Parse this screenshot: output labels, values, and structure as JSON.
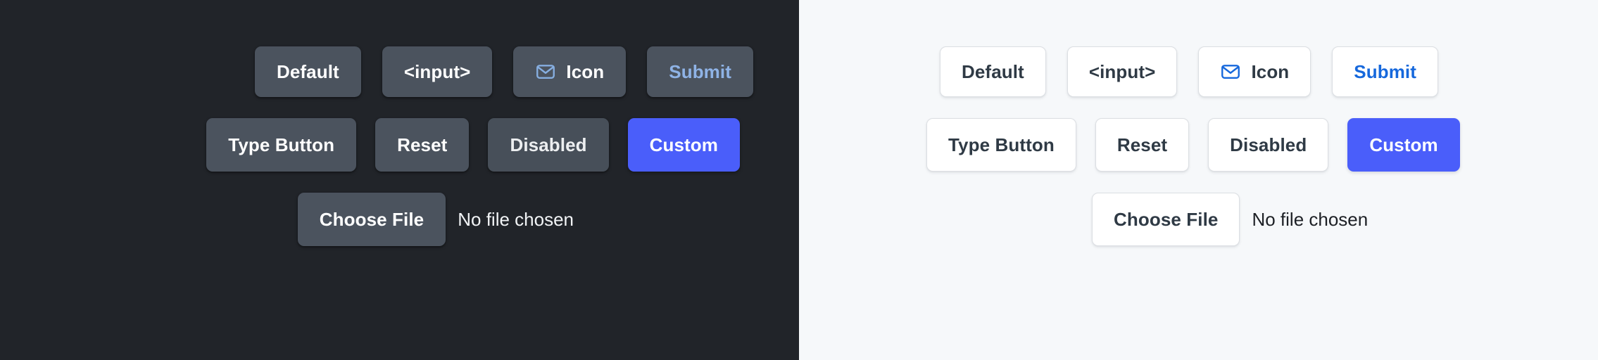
{
  "panels": [
    {
      "id": "dark",
      "theme": "dark",
      "background": "#212429",
      "button_bg": "#4b535e",
      "text_color": "#ffffff",
      "accent_color": "#4a5efa",
      "link_color": "#8fb3e6",
      "rows": [
        {
          "buttons": [
            {
              "label": "Default",
              "variant": "default"
            },
            {
              "label": "<input>",
              "variant": "default"
            },
            {
              "label": "Icon",
              "variant": "icon",
              "icon": "envelope-icon"
            },
            {
              "label": "Submit",
              "variant": "submit"
            }
          ]
        },
        {
          "buttons": [
            {
              "label": "Type Button",
              "variant": "default"
            },
            {
              "label": "Reset",
              "variant": "default"
            },
            {
              "label": "Disabled",
              "variant": "disabled"
            },
            {
              "label": "Custom",
              "variant": "custom"
            }
          ]
        }
      ],
      "file_input": {
        "button_label": "Choose File",
        "status_text": "No file chosen"
      }
    },
    {
      "id": "light",
      "theme": "light",
      "background": "#f6f8fa",
      "button_bg": "#ffffff",
      "text_color": "#2f3a45",
      "accent_color": "#4a5efa",
      "link_color": "#1668dc",
      "rows": [
        {
          "buttons": [
            {
              "label": "Default",
              "variant": "default"
            },
            {
              "label": "<input>",
              "variant": "default"
            },
            {
              "label": "Icon",
              "variant": "icon",
              "icon": "envelope-icon"
            },
            {
              "label": "Submit",
              "variant": "submit"
            }
          ]
        },
        {
          "buttons": [
            {
              "label": "Type Button",
              "variant": "default"
            },
            {
              "label": "Reset",
              "variant": "default"
            },
            {
              "label": "Disabled",
              "variant": "disabled"
            },
            {
              "label": "Custom",
              "variant": "custom"
            }
          ]
        }
      ],
      "file_input": {
        "button_label": "Choose File",
        "status_text": "No file chosen"
      }
    }
  ]
}
